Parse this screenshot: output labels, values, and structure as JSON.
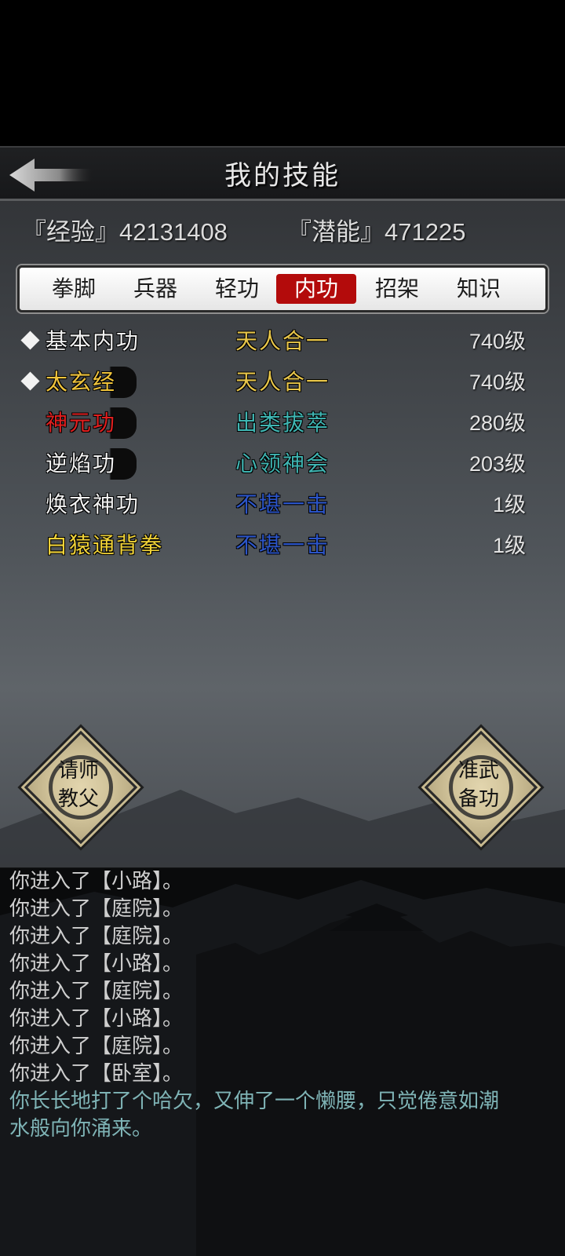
{
  "header": {
    "title": "我的技能",
    "back_icon": "back-arrow-icon"
  },
  "stats": {
    "experience": "『经验』42131408",
    "potential": "『潜能』471225"
  },
  "tabs": [
    {
      "label": "拳脚",
      "active": false
    },
    {
      "label": "兵器",
      "active": false
    },
    {
      "label": "轻功",
      "active": false
    },
    {
      "label": "内功",
      "active": true
    },
    {
      "label": "招架",
      "active": false
    },
    {
      "label": "知识",
      "active": false
    }
  ],
  "skills": [
    {
      "name": "基本内功",
      "level_text": "天人合一",
      "rank": "740级",
      "marked": true,
      "name_color": "#f2f2f2",
      "level_color": "#e8c64a"
    },
    {
      "name": "太玄经",
      "level_text": "天人合一",
      "rank": "740级",
      "marked": true,
      "name_color": "#f0c43c",
      "level_color": "#e8c64a"
    },
    {
      "name": "神元功",
      "level_text": "出类拔萃",
      "rank": "280级",
      "marked": false,
      "name_color": "#e01f1f",
      "level_color": "#3fb5b2"
    },
    {
      "name": "逆焰功",
      "level_text": "心领神会",
      "rank": "203级",
      "marked": false,
      "name_color": "#f2f2f2",
      "level_color": "#3fb5b2"
    },
    {
      "name": "焕衣神功",
      "level_text": "不堪一击",
      "rank": "1级",
      "marked": false,
      "name_color": "#f2f2f2",
      "level_color": "#2c55c8"
    },
    {
      "name": "白猿通背拳",
      "level_text": "不堪一击",
      "rank": "1级",
      "marked": false,
      "name_color": "#f0d238",
      "level_color": "#2c55c8"
    }
  ],
  "buttons": {
    "left": {
      "line1": "请师",
      "line2": "教父"
    },
    "right": {
      "line1": "准武",
      "line2": "备功"
    }
  },
  "log": [
    {
      "text": "你进入了【小路】。",
      "highlight": false
    },
    {
      "text": "你进入了【庭院】。",
      "highlight": false
    },
    {
      "text": "你进入了【庭院】。",
      "highlight": false
    },
    {
      "text": "你进入了【小路】。",
      "highlight": false
    },
    {
      "text": "你进入了【庭院】。",
      "highlight": false
    },
    {
      "text": "你进入了【小路】。",
      "highlight": false
    },
    {
      "text": "你进入了【庭院】。",
      "highlight": false
    },
    {
      "text": "你进入了【卧室】。",
      "highlight": false
    },
    {
      "text": "你长长地打了个哈欠，又伸了一个懒腰，只觉倦意如潮",
      "highlight": true
    },
    {
      "text": "水般向你涌来。",
      "highlight": true
    }
  ]
}
